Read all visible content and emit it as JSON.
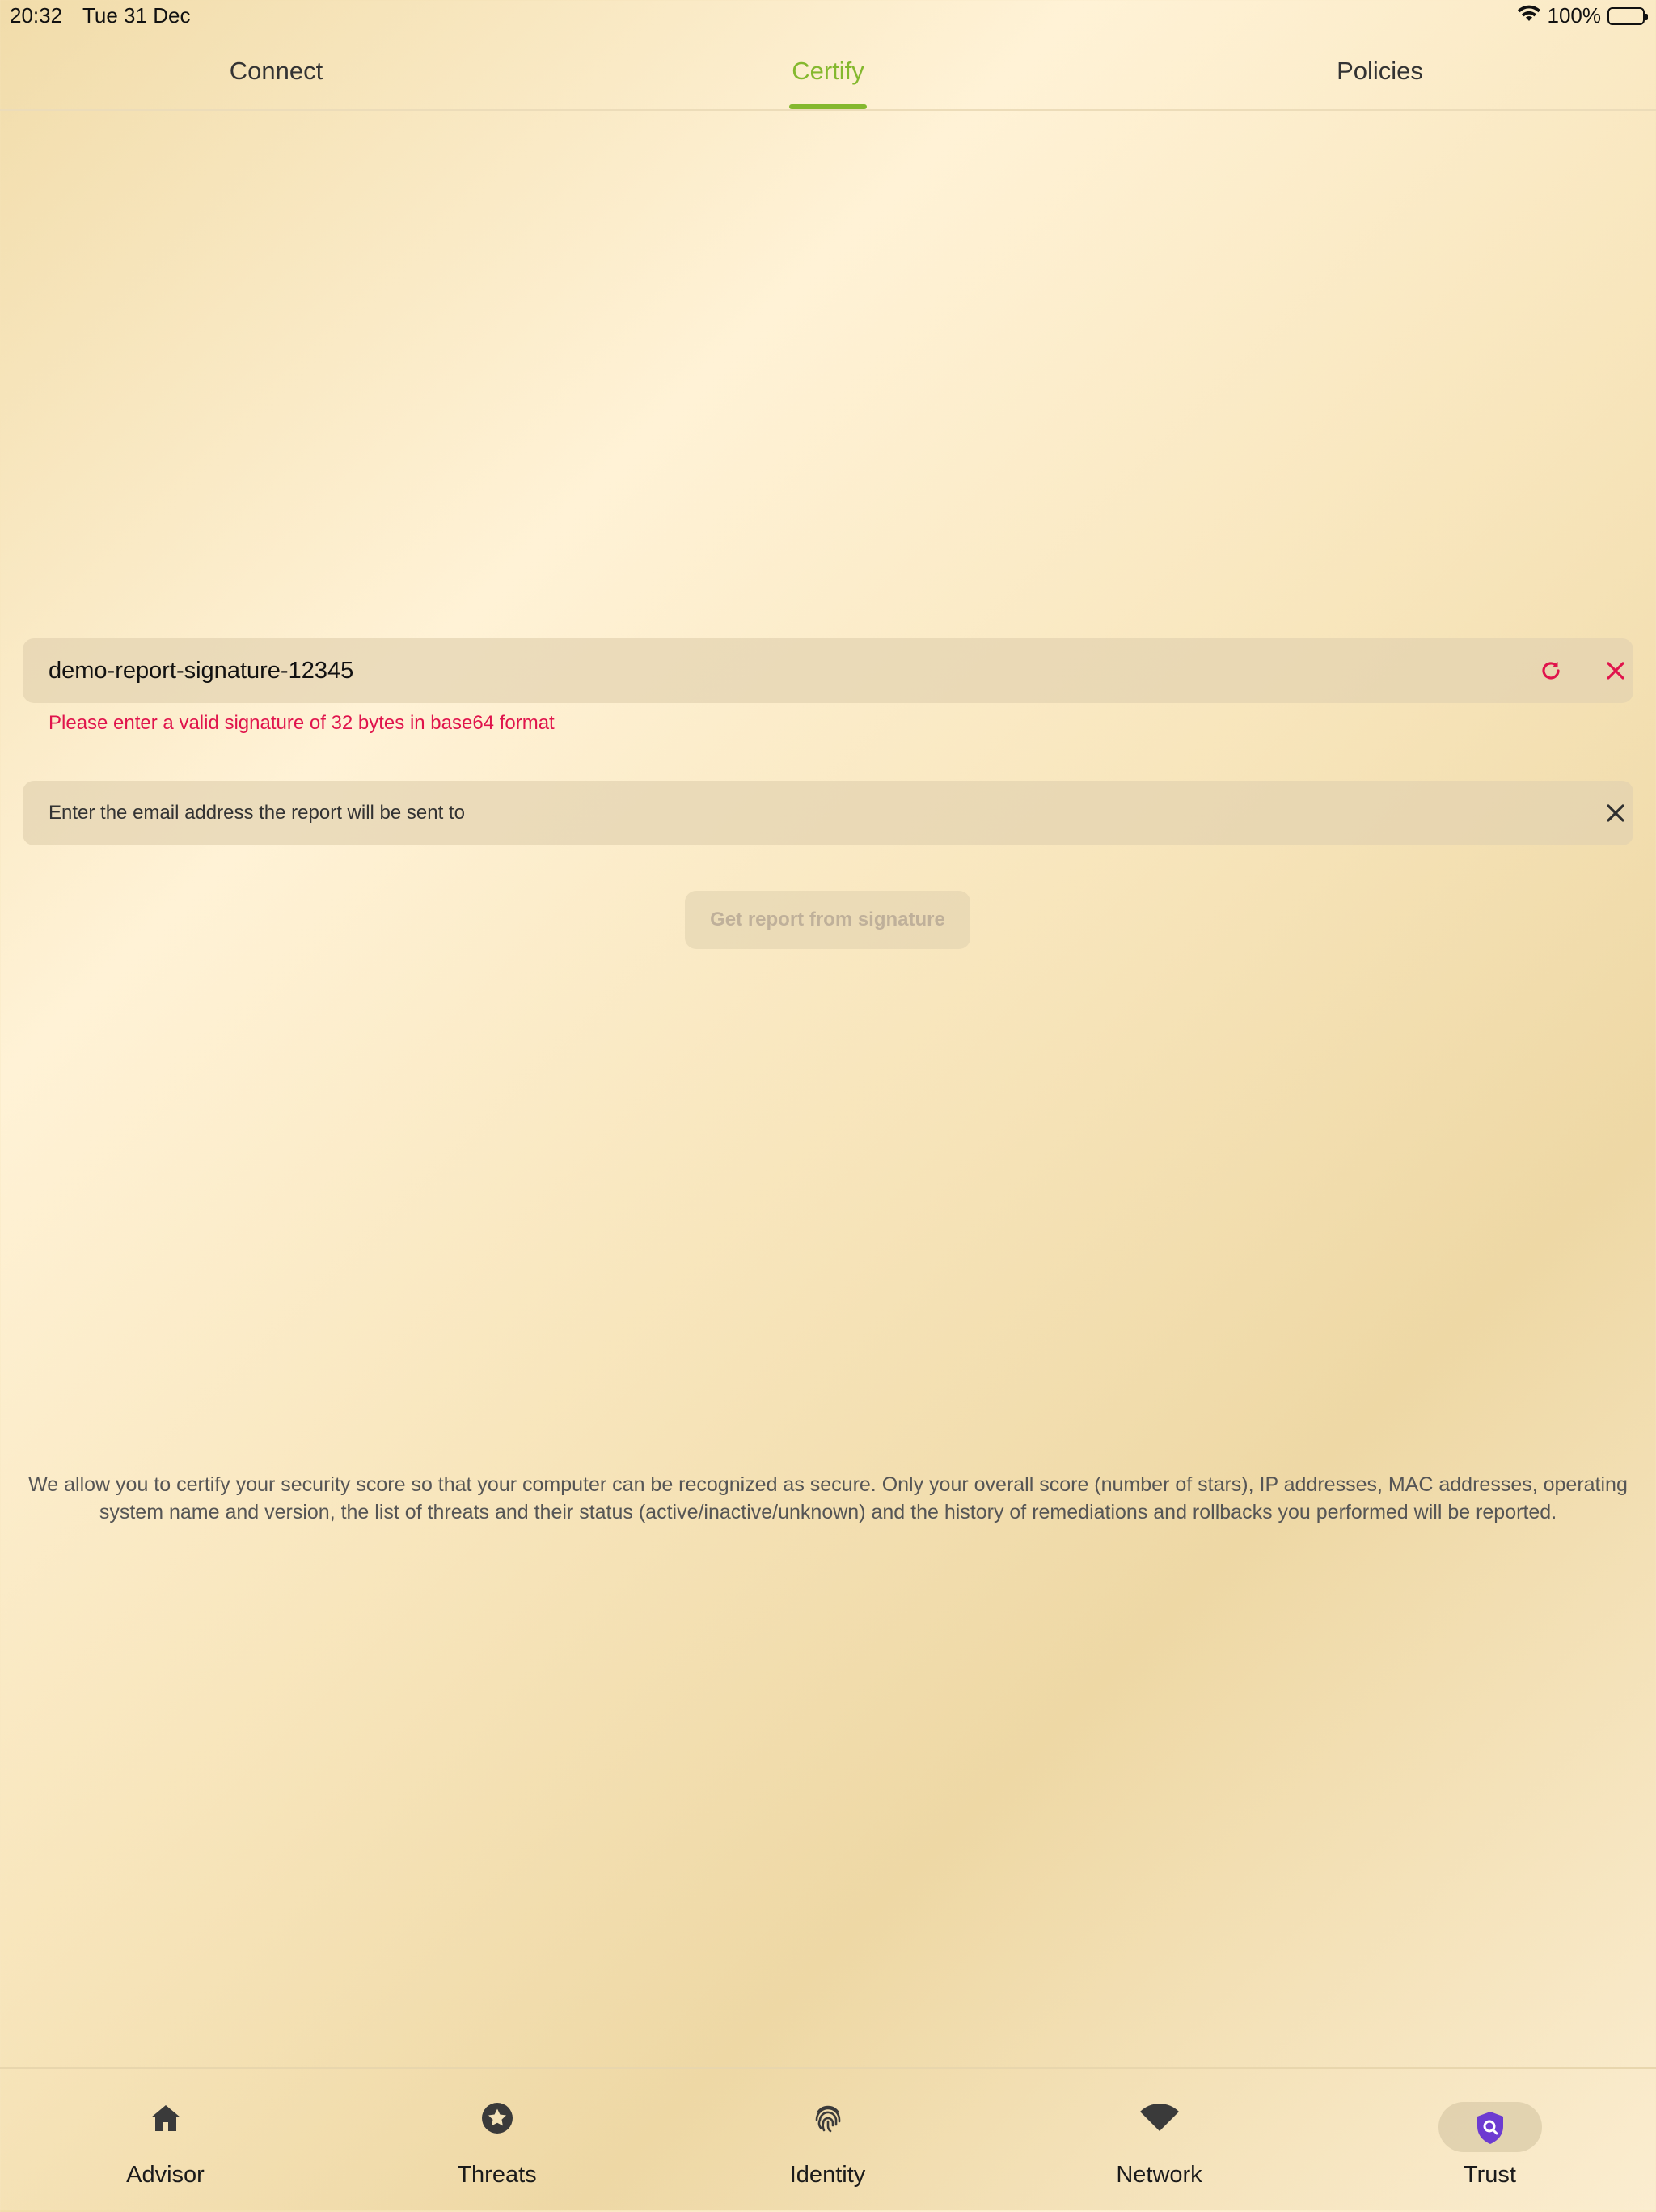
{
  "status_bar": {
    "time": "20:32",
    "date": "Tue 31 Dec",
    "battery": "100%"
  },
  "tabs": [
    {
      "label": "Connect",
      "active": false
    },
    {
      "label": "Certify",
      "active": true
    },
    {
      "label": "Policies",
      "active": false
    }
  ],
  "signature_field": {
    "value": "demo-report-signature-12345",
    "error": "Please enter a valid signature of 32 bytes in base64 format"
  },
  "email_field": {
    "placeholder": "Enter the email address the report will be sent to",
    "value": ""
  },
  "get_report_button": {
    "label": "Get report from signature",
    "enabled": false
  },
  "description": "We allow you to certify your security score so that your computer can be recognized as secure. Only your overall score (number of stars), IP addresses, MAC addresses, operating system name and version, the list of threats and their status (active/inactive/unknown) and the history of remediations and rollbacks you performed will be reported.",
  "bottom_nav": [
    {
      "label": "Advisor",
      "icon": "home-icon"
    },
    {
      "label": "Threats",
      "icon": "star-badge-icon"
    },
    {
      "label": "Identity",
      "icon": "fingerprint-icon"
    },
    {
      "label": "Network",
      "icon": "wifi-icon"
    },
    {
      "label": "Trust",
      "icon": "shield-search-icon",
      "active": true
    }
  ],
  "colors": {
    "accent": "#84b82e",
    "error": "#e0144c",
    "trust_icon": "#6d3bd1"
  }
}
